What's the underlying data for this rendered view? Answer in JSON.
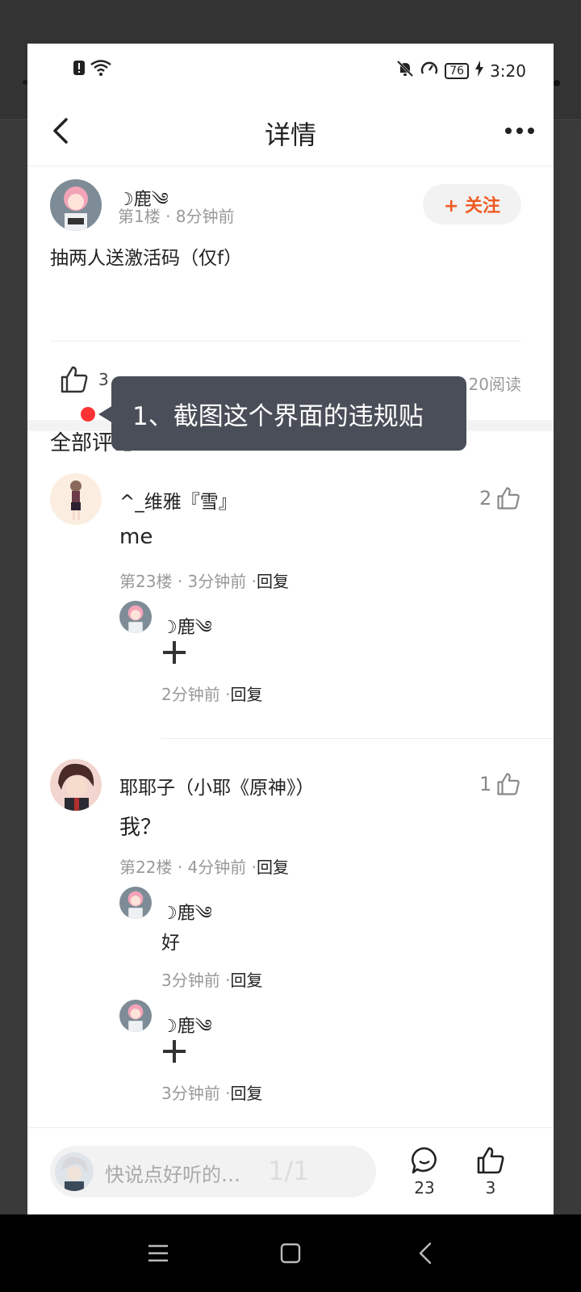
{
  "status_bar": {
    "battery": "76",
    "time": "3:20"
  },
  "header": {
    "title": "详情"
  },
  "post": {
    "author": "☽鹿༄",
    "meta": "第1楼 · 8分钟前",
    "follow_label": "+ 关注",
    "content": "抽两人送激活码（仅f）",
    "likes": "3",
    "reads": "20阅读"
  },
  "tooltip": {
    "text": "1、截图这个界面的违规贴"
  },
  "comments_header": "全部评论23",
  "comments": [
    {
      "name": "^_维雅『雪』",
      "text": "me",
      "meta": "第23楼 · 3分钟前 ·",
      "reply_label": "回复",
      "likes": "2",
      "replies": [
        {
          "name": "☽鹿༄",
          "text": "",
          "meta": "2分钟前 ·",
          "reply_label": "回复"
        }
      ]
    },
    {
      "name": "耶耶子（小耶《原神》）",
      "text": "我？",
      "meta": "第22楼 · 4分钟前 ·",
      "reply_label": "回复",
      "likes": "1",
      "replies": [
        {
          "name": "☽鹿༄",
          "text": "好",
          "meta": "3分钟前 ·",
          "reply_label": "回复"
        },
        {
          "name": "☽鹿༄",
          "text": "",
          "meta": "3分钟前 ·",
          "reply_label": "回复"
        }
      ]
    }
  ],
  "bottom_bar": {
    "input_placeholder": "快说点好听的…",
    "page_indicator": "1/1",
    "comment_count": "23",
    "like_count": "3"
  },
  "colors": {
    "accent": "#f05a22",
    "tooltip_bg": "#4a4e59",
    "red_dot": "#ff3333"
  }
}
